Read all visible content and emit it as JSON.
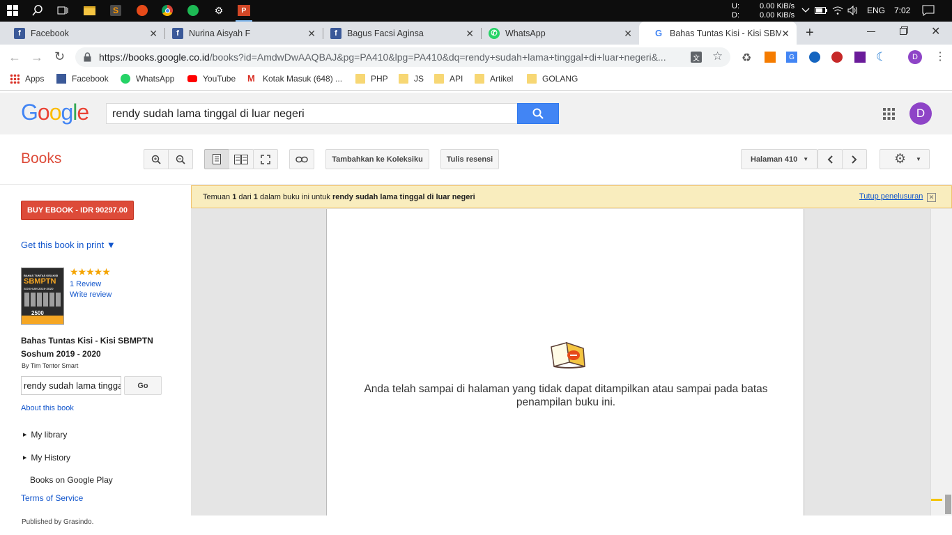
{
  "taskbar": {
    "tray": {
      "upload_label": "U:",
      "upload_value": "0.00 KiB/s",
      "download_label": "D:",
      "download_value": "0.00 KiB/s",
      "language": "ENG",
      "time": "7:02"
    }
  },
  "tabs": [
    {
      "label": "Facebook",
      "icon": "facebook-icon",
      "color": "#3b5998"
    },
    {
      "label": "Nurina Aisyah F",
      "icon": "facebook-icon",
      "color": "#3b5998"
    },
    {
      "label": "Bagus Facsi Aginsa",
      "icon": "facebook-icon",
      "color": "#3b5998"
    },
    {
      "label": "WhatsApp",
      "icon": "whatsapp-icon",
      "color": "#25d366"
    },
    {
      "label": "Bahas Tuntas Kisi - Kisi SBMPTN",
      "icon": "google-icon",
      "color": "#4285f4"
    }
  ],
  "address": {
    "url_host": "https://books.google.co.id",
    "url_path": "/books?id=AmdwDwAAQBAJ&pg=PA410&lpg=PA410&dq=rendy+sudah+lama+tinggal+di+luar+negeri&..."
  },
  "bookmarks": {
    "items": [
      {
        "label": "Apps"
      },
      {
        "label": "Facebook"
      },
      {
        "label": "WhatsApp"
      },
      {
        "label": "YouTube"
      },
      {
        "label": "Kotak Masuk (648) ..."
      },
      {
        "label": "PHP"
      },
      {
        "label": "JS"
      },
      {
        "label": "API"
      },
      {
        "label": "Artikel"
      },
      {
        "label": "GOLANG"
      }
    ]
  },
  "google": {
    "search_value": "rendy sudah lama tinggal di luar negeri",
    "avatar_letter": "D"
  },
  "books": {
    "title": "Books",
    "add_collection": "Tambahkan ke Koleksiku",
    "write_review": "Tulis resensi",
    "page_select": "Halaman 410"
  },
  "left": {
    "buy_button": "BUY EBOOK - IDR 90297.00",
    "get_print": "Get this book in print ▼",
    "stars": "★★★★★",
    "rating_value": 5,
    "reviews": "1 Review",
    "write_review": "Write review",
    "book_title_line1": "Bahas Tuntas Kisi - Kisi SBMPTN",
    "book_title_line2": "Soshum 2019 - 2020",
    "author": "By Tim Tentor Smart",
    "search_value": "rendy sudah lama tinggal di luar negeri",
    "go_button": "Go",
    "about": "About this book",
    "my_library": "My library",
    "my_history": "My History",
    "books_play": "Books on Google Play",
    "terms": "Terms of Service",
    "published": "Published by Grasindo.",
    "cover": {
      "line1": "BAHAS TUNTAS KISI-KISI",
      "line2": "SBMPTN",
      "line3": "SOSHUM 2019-2020",
      "count": "2500"
    }
  },
  "notice": {
    "prefix": "Temuan ",
    "found": "1",
    "middle": " dari ",
    "total": "1",
    "suffix": " dalam buku ini untuk ",
    "query": "rendy sudah lama tinggal di luar negeri",
    "close_link": "Tutup penelusuran"
  },
  "viewer": {
    "message_line1": "Anda telah sampai di halaman yang tidak dapat ditampilkan atau sampai pada batas",
    "message_line2": "penampilan buku ini."
  }
}
